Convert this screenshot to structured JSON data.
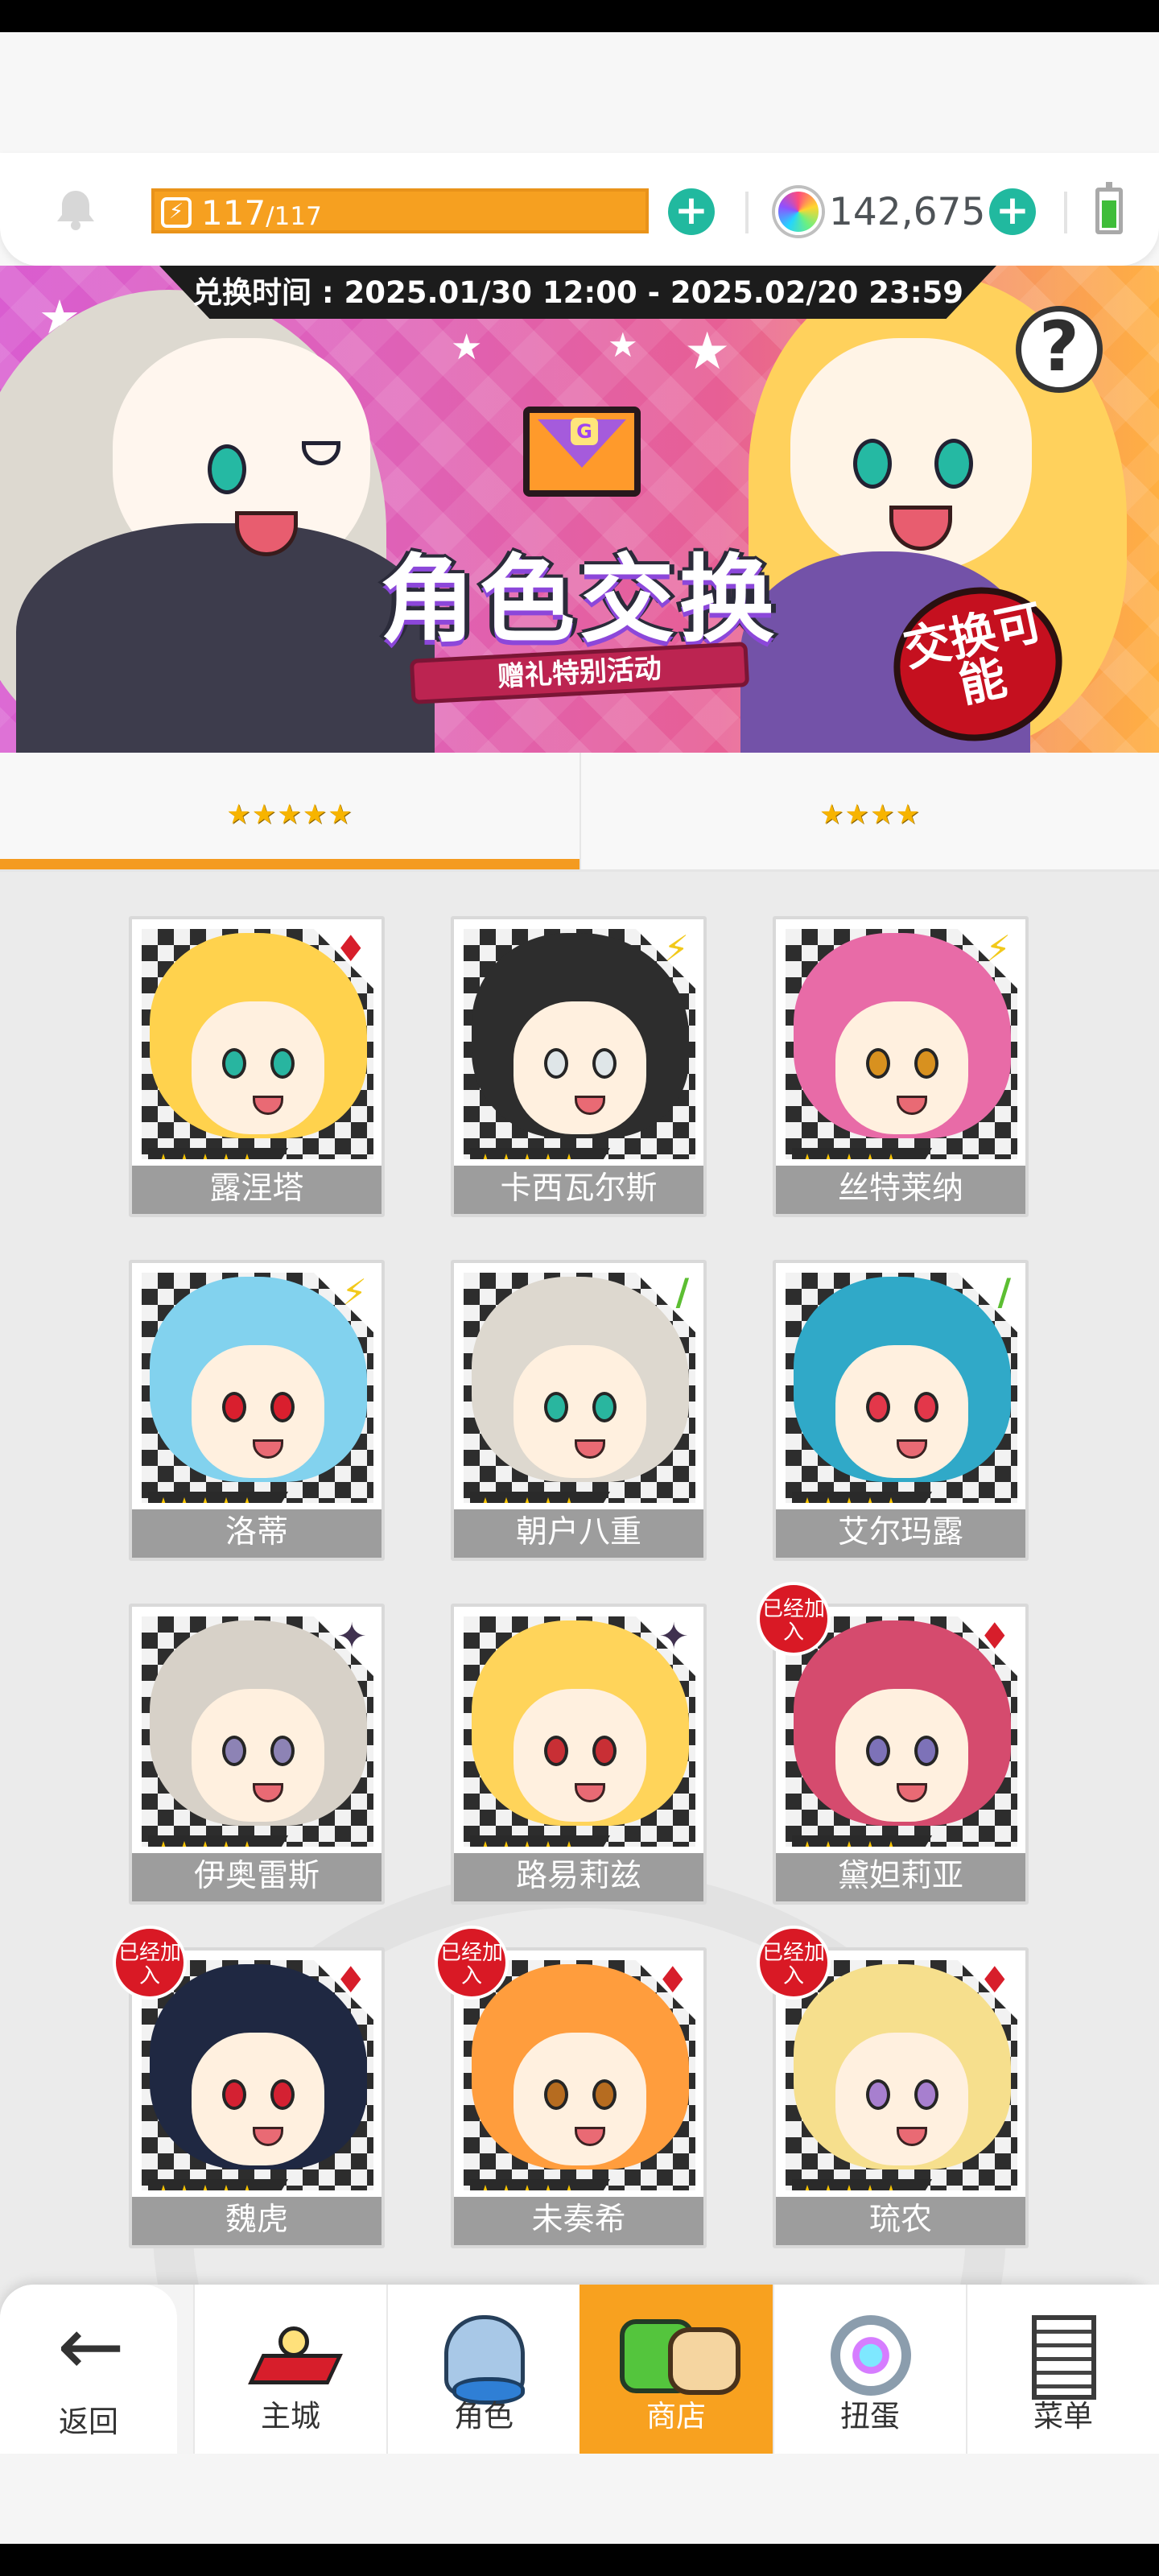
{
  "header": {
    "energy": {
      "current": "117",
      "max": "/117"
    },
    "currency": "142,675",
    "icons": [
      "bell-icon",
      "lightning-icon",
      "add-energy-icon",
      "gem-icon",
      "add-gem-icon",
      "battery-icon"
    ]
  },
  "banner": {
    "exchange_time": "兑换时间 : 2025.01/30 12:00 - 2025.02/20 23:59",
    "title": "角色交换",
    "subtitle": "赠礼特别活动",
    "badge": "交换可能",
    "help": "?"
  },
  "tabs": [
    {
      "label": "★★★★★",
      "active": true
    },
    {
      "label": "★★★★",
      "active": false
    }
  ],
  "characters": [
    {
      "name": "露涅塔",
      "element": "♦",
      "stars": "★★★★★",
      "joined": false,
      "hair": "#ffd24d",
      "eyes": "#28b5a0"
    },
    {
      "name": "卡西瓦尔斯",
      "element": "⚡",
      "stars": "★★★★★",
      "joined": false,
      "hair": "#2d2d2d",
      "eyes": "#dfe6e8"
    },
    {
      "name": "丝特莱纳",
      "element": "⚡",
      "stars": "★★★★★",
      "joined": false,
      "hair": "#e86ba7",
      "eyes": "#d8911f"
    },
    {
      "name": "洛蒂",
      "element": "⚡",
      "stars": "★★★★★",
      "joined": false,
      "hair": "#82d2ee",
      "eyes": "#d91f2e"
    },
    {
      "name": "朝户八重",
      "element": "/",
      "stars": "★★★★★",
      "joined": false,
      "hair": "#ddd8cf",
      "eyes": "#29b69f"
    },
    {
      "name": "艾尔玛露",
      "element": "/",
      "stars": "★★★★★",
      "joined": false,
      "hair": "#30a9c8",
      "eyes": "#e3374a"
    },
    {
      "name": "伊奥雷斯",
      "element": "✦",
      "stars": "★★★★★",
      "joined": false,
      "hair": "#d7d1c8",
      "eyes": "#8d83b5"
    },
    {
      "name": "路易莉兹",
      "element": "✦",
      "stars": "★★★★★",
      "joined": false,
      "hair": "#ffd45a",
      "eyes": "#c82f35"
    },
    {
      "name": "黛妲莉亚",
      "element": "♦",
      "stars": "★★★★★",
      "joined": true,
      "joined_label": "已经加入",
      "hair": "#d54b6e",
      "eyes": "#7d72b8"
    },
    {
      "name": "魏虎",
      "element": "♦",
      "stars": "★★★★★",
      "joined": true,
      "joined_label": "已经加入",
      "hair": "#1f2842",
      "eyes": "#d42132"
    },
    {
      "name": "未奏希",
      "element": "♦",
      "stars": "★★★★★",
      "joined": true,
      "joined_label": "已经加入",
      "hair": "#ff9d3d",
      "eyes": "#b66c20"
    },
    {
      "name": "琉农",
      "element": "♦",
      "stars": "★★★★★",
      "joined": true,
      "joined_label": "已经加入",
      "hair": "#f6df8d",
      "eyes": "#a77fcf"
    }
  ],
  "bottom_nav": [
    {
      "label": "返回",
      "icon": "back-arrow-icon"
    },
    {
      "label": "主城",
      "icon": "home-icon"
    },
    {
      "label": "角色",
      "icon": "role-icon"
    },
    {
      "label": "商店",
      "icon": "shop-icon",
      "active": true
    },
    {
      "label": "扭蛋",
      "icon": "gacha-icon"
    },
    {
      "label": "菜单",
      "icon": "menu-icon"
    }
  ],
  "colors": {
    "accent": "#f49b20",
    "fire": "#d71e2b",
    "lightning": "#f2c91b",
    "nature": "#5cbe32",
    "dark": "#40314f"
  }
}
